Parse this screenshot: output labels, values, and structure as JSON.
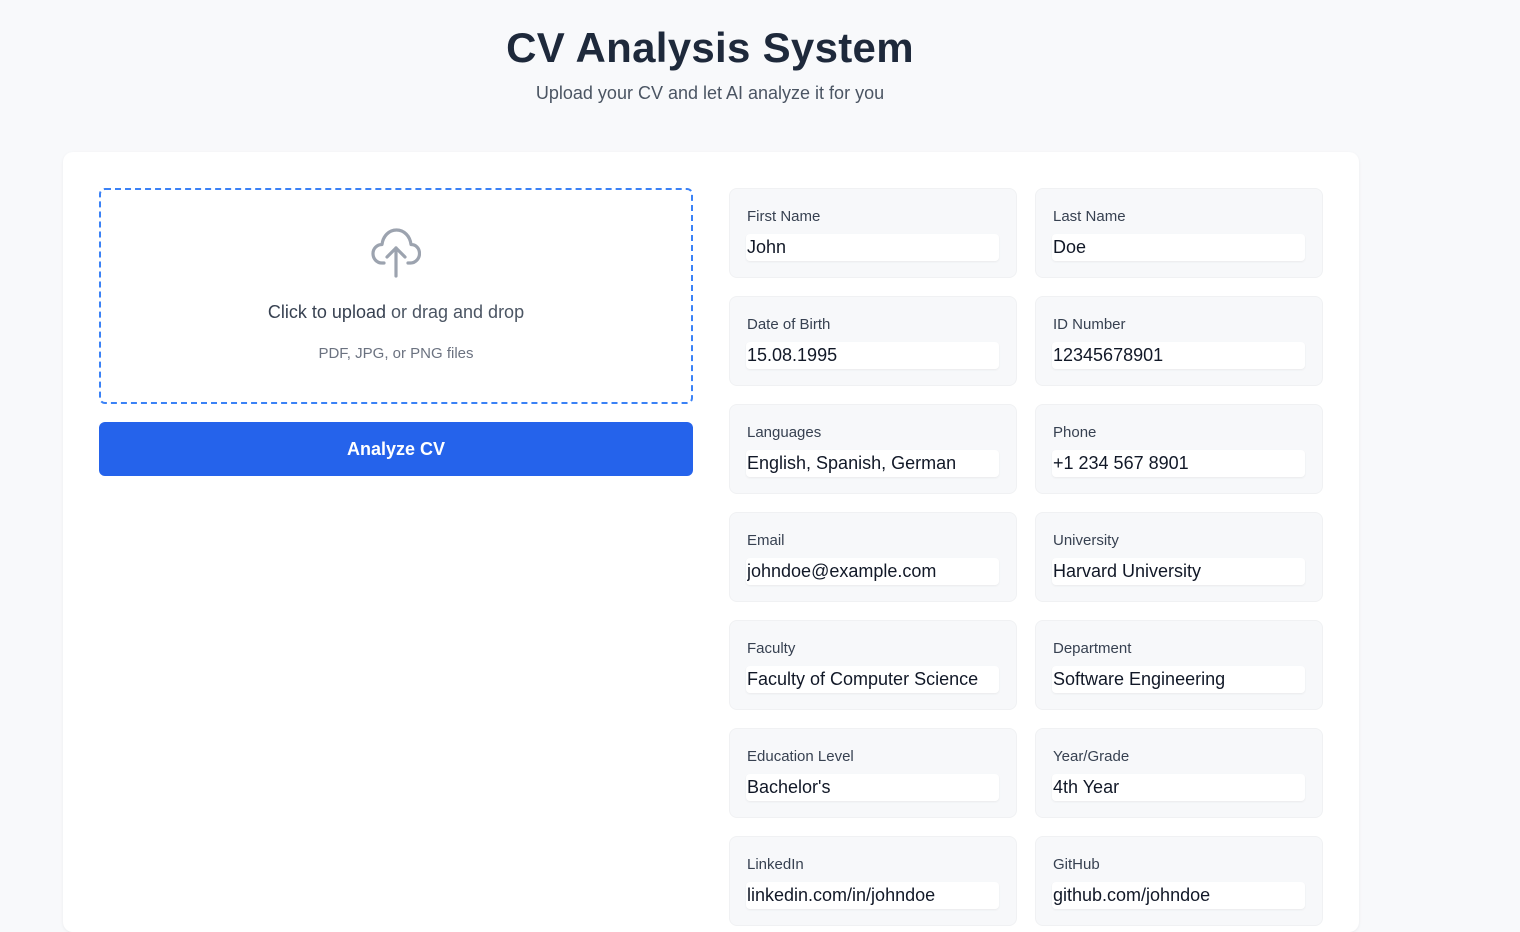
{
  "header": {
    "title": "CV Analysis System",
    "subtitle": "Upload your CV and let AI analyze it for you"
  },
  "upload": {
    "icon": "cloud-upload-icon",
    "click_text": "Click to upload",
    "drag_text": " or drag and drop",
    "hint": "PDF, JPG, or PNG files"
  },
  "analyze_button": "Analyze CV",
  "fields": [
    {
      "label": "First Name",
      "value": "John"
    },
    {
      "label": "Last Name",
      "value": "Doe"
    },
    {
      "label": "Date of Birth",
      "value": "15.08.1995"
    },
    {
      "label": "ID Number",
      "value": "12345678901"
    },
    {
      "label": "Languages",
      "value": "English, Spanish, German"
    },
    {
      "label": "Phone",
      "value": "+1 234 567 8901"
    },
    {
      "label": "Email",
      "value": "johndoe@example.com"
    },
    {
      "label": "University",
      "value": "Harvard University"
    },
    {
      "label": "Faculty",
      "value": "Faculty of Computer Science"
    },
    {
      "label": "Department",
      "value": "Software Engineering"
    },
    {
      "label": "Education Level",
      "value": "Bachelor's"
    },
    {
      "label": "Year/Grade",
      "value": "4th Year"
    },
    {
      "label": "LinkedIn",
      "value": "linkedin.com/in/johndoe"
    },
    {
      "label": "GitHub",
      "value": "github.com/johndoe"
    }
  ],
  "colors": {
    "accent": "#2563eb",
    "dropzone_border": "#3b82f6",
    "background": "#f8f9fb"
  }
}
